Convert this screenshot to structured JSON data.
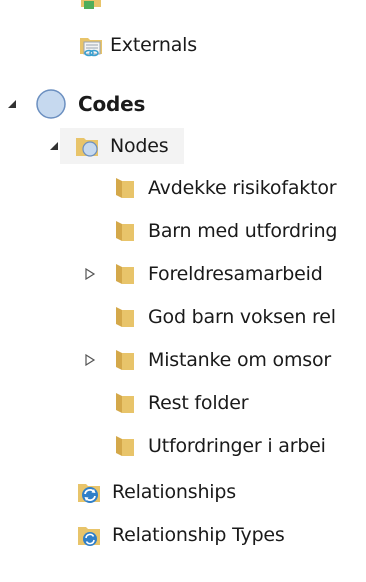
{
  "tree": {
    "externals": {
      "label": "Externals",
      "icon": "externals-icon"
    },
    "codes": {
      "label": "Codes",
      "icon": "codes-circle-icon",
      "expanded": true
    },
    "nodes": {
      "label": "Nodes",
      "icon": "nodes-folder-icon",
      "expanded": true
    },
    "node_items": [
      {
        "label": "Avdekke risikofaktor",
        "expandable": false
      },
      {
        "label": "Barn med utfordring",
        "expandable": false
      },
      {
        "label": "Foreldresamarbeid",
        "expandable": true
      },
      {
        "label": "God barn voksen rel",
        "expandable": false
      },
      {
        "label": "Mistanke om omsor",
        "expandable": true
      },
      {
        "label": "Rest folder",
        "expandable": false
      },
      {
        "label": "Utfordringer i arbei",
        "expandable": false
      }
    ],
    "relationships": {
      "label": "Relationships",
      "icon": "relationships-icon"
    },
    "relationship_types": {
      "label": "Relationship Types",
      "icon": "relationship-types-icon"
    }
  },
  "colors": {
    "folder_yellow": "#e8c46a",
    "folder_dark": "#d4a84a",
    "codes_blue": "#b8d0ea",
    "codes_border": "#6b8fc0",
    "expander": "#444444",
    "expander_open": "#333333"
  }
}
